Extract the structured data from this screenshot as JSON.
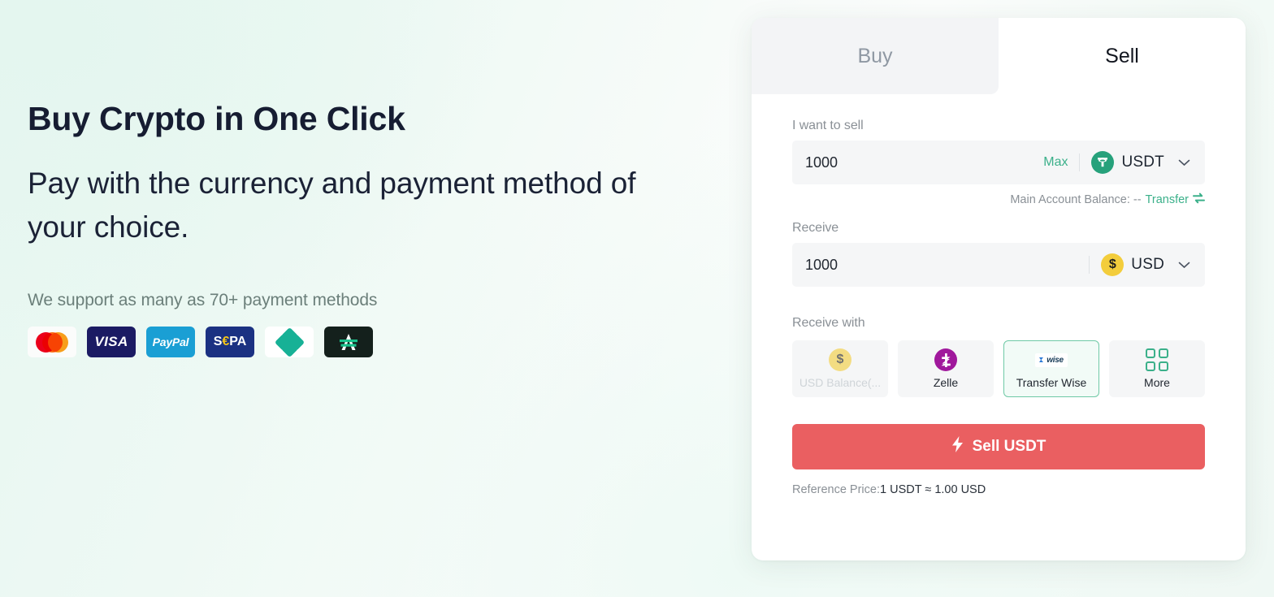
{
  "hero": {
    "headline": "Buy Crypto in One Click",
    "subheadline": "Pay with the currency and payment method of your choice.",
    "support_text": "We support as many as 70+ payment methods",
    "payment_logos": [
      {
        "name": "mastercard-logo",
        "label": "Mastercard"
      },
      {
        "name": "visa-logo",
        "label": "VISA"
      },
      {
        "name": "paypal-logo",
        "label": "PayPal"
      },
      {
        "name": "sepa-logo",
        "label": "SEPA",
        "prefix": "S",
        "euro": "€",
        "suffix": "PA"
      },
      {
        "name": "diamond-logo",
        "label": "Diamond"
      },
      {
        "name": "advcash-logo",
        "label": "Advcash"
      }
    ]
  },
  "widget": {
    "tabs": [
      {
        "label": "Buy",
        "active": false
      },
      {
        "label": "Sell",
        "active": true
      }
    ],
    "sell_field": {
      "label": "I want to sell",
      "amount": "1000",
      "placeholder": "0.00",
      "max_label": "Max",
      "currency": "USDT",
      "currency_symbol": "₮",
      "chevron": "chevron-down-icon"
    },
    "balance": {
      "text": "Main Account Balance: --",
      "transfer_label": "Transfer",
      "transfer_icon": "transfer-swap-icon"
    },
    "receive_field": {
      "label": "Receive",
      "amount": "1000",
      "placeholder": "0.00",
      "currency": "USD",
      "currency_symbol": "$"
    },
    "receive_with": {
      "label": "Receive with",
      "methods": [
        {
          "label": "USD Balance(...",
          "icon": "usd-coin-icon",
          "selected": false,
          "disabled": true
        },
        {
          "label": "Zelle",
          "icon": "zelle-icon",
          "selected": false,
          "disabled": false
        },
        {
          "label": "Transfer Wise",
          "icon": "wise-icon",
          "icon_text": "wise",
          "selected": true,
          "disabled": false
        },
        {
          "label": "More",
          "icon": "grid-more-icon",
          "selected": false,
          "disabled": false
        }
      ]
    },
    "cta": {
      "label": "Sell USDT",
      "icon": "lightning-bolt-icon"
    },
    "reference": {
      "label": "Reference Price:",
      "value": "1 USDT ≈ 1.00 USD"
    }
  },
  "colors": {
    "accent_green": "#3bb08a",
    "cta_red": "#ea5f61",
    "usdt_green": "#26a17b",
    "usd_yellow": "#f3cd3c",
    "zelle_purple": "#a0189c",
    "heading_navy": "#161d32"
  }
}
